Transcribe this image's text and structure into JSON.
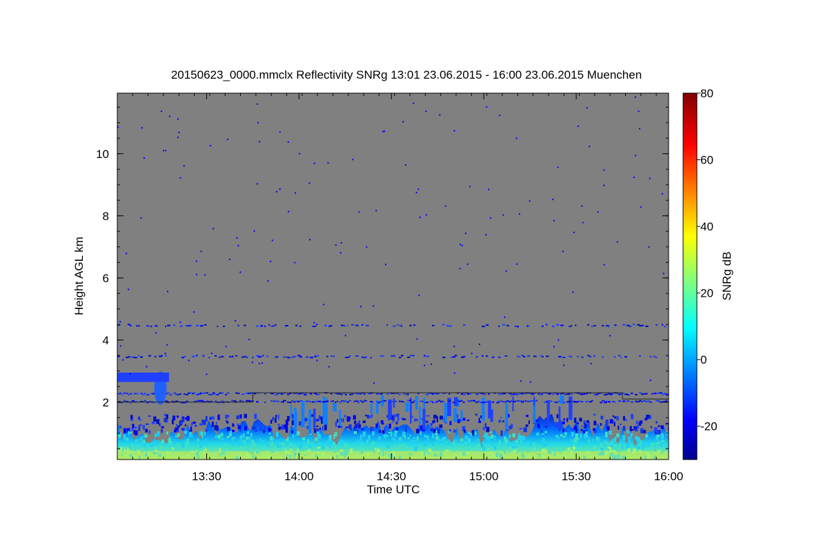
{
  "chart_data": {
    "type": "heatmap",
    "title": "20150623_0000.mmclx Reflectivity SNRg   13:01 23.06.2015 - 16:00 23.06.2015 Muenchen",
    "xlabel": "Time UTC",
    "ylabel": "Height AGL km",
    "xlim": [
      "13:01",
      "16:00"
    ],
    "ylim": [
      0.15,
      11.95
    ],
    "x_ticks": [
      "13:30",
      "14:00",
      "14:30",
      "15:00",
      "15:30",
      "16:00"
    ],
    "y_ticks": [
      "2",
      "4",
      "6",
      "8",
      "10"
    ],
    "colorbar": {
      "label": "SNRg dB",
      "range": [
        -30,
        80
      ],
      "ticks": [
        "-20",
        "0",
        "20",
        "40",
        "60",
        "80"
      ],
      "colormap": "jet"
    },
    "background_color": "#808080",
    "features": [
      {
        "name": "boundary layer echoes",
        "height_km": [
          0.15,
          1.9
        ],
        "snr_db": [
          -25,
          40
        ]
      },
      {
        "name": "layer",
        "height_km": 2.3,
        "snr_db": -25
      },
      {
        "name": "layer",
        "height_km": 2.05,
        "snr_db": -25
      },
      {
        "name": "layer",
        "height_km": 3.5,
        "snr_db": -25
      },
      {
        "name": "layer",
        "height_km": 4.5,
        "snr_db": -25
      },
      {
        "name": "elevated echo",
        "time": "13:15",
        "height_km": [
          1.9,
          3.0
        ],
        "snr_db": [
          -15,
          5
        ]
      }
    ]
  }
}
